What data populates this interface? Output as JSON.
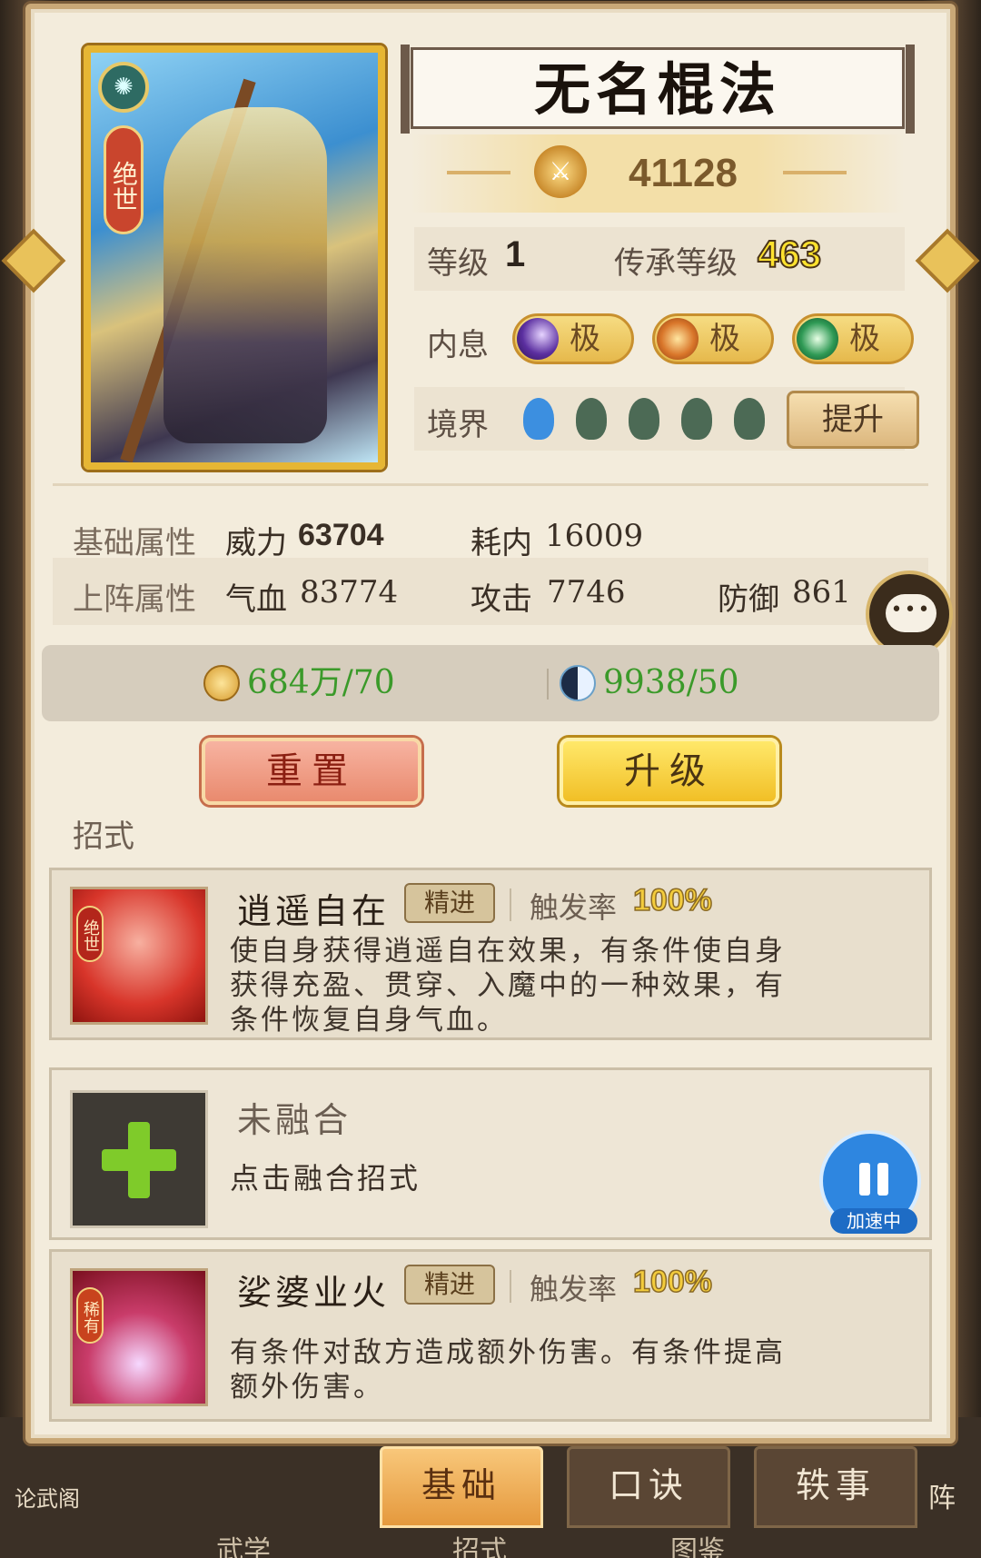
{
  "header": {
    "title": "无名棍法",
    "power": "41128"
  },
  "card": {
    "rank_label": "绝世"
  },
  "level": {
    "label": "等级",
    "value": "1",
    "inherit_label": "传承等级",
    "inherit_value": "463"
  },
  "inner": {
    "label": "内息",
    "items": [
      {
        "text": "极",
        "color": "#5b2fa0"
      },
      {
        "text": "极",
        "color": "#d9762a"
      },
      {
        "text": "极",
        "color": "#2f9a55"
      }
    ]
  },
  "realm": {
    "label": "境界",
    "drops": [
      {
        "color": "#3c8fe0"
      },
      {
        "color": "#4c6a55"
      },
      {
        "color": "#4c6a55"
      },
      {
        "color": "#4c6a55"
      },
      {
        "color": "#4c6a55"
      }
    ],
    "upgrade_button": "提升"
  },
  "attributes": {
    "base_label": "基础属性",
    "power_label": "威力",
    "power_value": "63704",
    "cost_label": "耗内",
    "cost_value": "16009",
    "battle_label": "上阵属性",
    "hp_label": "气血",
    "hp_value": "83774",
    "atk_label": "攻击",
    "atk_value": "7746",
    "def_label": "防御",
    "def_value": "861"
  },
  "costs": {
    "coin": "684万/70",
    "yinyang": "9938/50"
  },
  "buttons": {
    "reset": "重置",
    "upgrade": "升级"
  },
  "moves": {
    "section_label": "招式",
    "skill1": {
      "name": "逍遥自在",
      "tag": "精进",
      "rate_label": "触发率",
      "rate_value": "100%",
      "rank": "绝世",
      "desc_lines": [
        "使自身获得逍遥自在效果，有条件使自身",
        "获得充盈、贯穿、入魔中的一种效果，有",
        "条件恢复自身气血。"
      ]
    },
    "fuse": {
      "title": "未融合",
      "hint": "点击融合招式"
    },
    "skill2": {
      "name": "娑婆业火",
      "tag": "精进",
      "rate_label": "触发率",
      "rate_value": "100%",
      "rank": "稀有",
      "desc_lines": [
        "有条件对敌方造成额外伤害。有条件提高",
        "额外伤害。"
      ]
    }
  },
  "speed": {
    "label": "加速中"
  },
  "tabs": [
    {
      "label": "基础",
      "active": true
    },
    {
      "label": "口诀",
      "active": false
    },
    {
      "label": "轶事",
      "active": false
    }
  ],
  "bottom": {
    "left_label": "论武阁",
    "right_label": "阵",
    "tabs2": [
      "武学",
      "招式",
      "图鉴"
    ]
  },
  "colors": {
    "accent_gold": "#ffe22e",
    "cost_green": "#3b9a2a",
    "panel_bg": "#f3ecdc"
  }
}
